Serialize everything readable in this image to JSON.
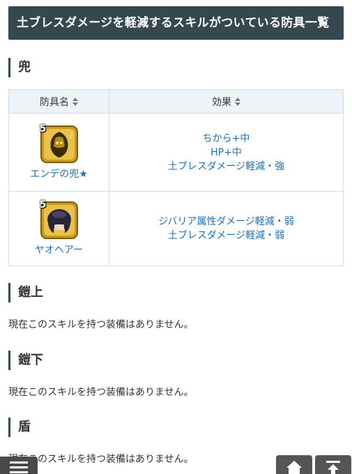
{
  "page": {
    "title": "土ブレスダメージを軽減するスキルがついている防具一覧"
  },
  "sections": {
    "kabuto": {
      "heading": "兜"
    },
    "yoroi_ue": {
      "heading": "鎧上",
      "note": "現在このスキルを持つ装備はありません。"
    },
    "yoroi_shita": {
      "heading": "鎧下",
      "note": "現在このスキルを持つ装備はありません。"
    },
    "tate": {
      "heading": "盾",
      "note": "現在このスキルを持つ装備はありません。"
    }
  },
  "table": {
    "headers": {
      "name": "防具名",
      "effect": "効果"
    },
    "rows": [
      {
        "rarity": "5",
        "name": "エンデの兜★",
        "icon": "golden-helmet-icon",
        "effects": [
          "ちから+中",
          "HP+中",
          "土ブレスダメージ軽減・強"
        ]
      },
      {
        "rarity": "5",
        "name": "ヤオヘアー",
        "icon": "dark-hair-icon",
        "effects": [
          "ジバリア属性ダメージ軽減・弱",
          "土ブレスダメージ軽減・弱"
        ]
      }
    ]
  },
  "nav": {
    "menu_icon": "hamburger-menu-icon",
    "home_icon": "home-icon",
    "top_icon": "scroll-to-top-icon"
  },
  "colors": {
    "header_bg": "#37474f",
    "link": "#1e6fb8",
    "table_border": "#cfdde6",
    "table_head_bg": "#eef3f7"
  }
}
